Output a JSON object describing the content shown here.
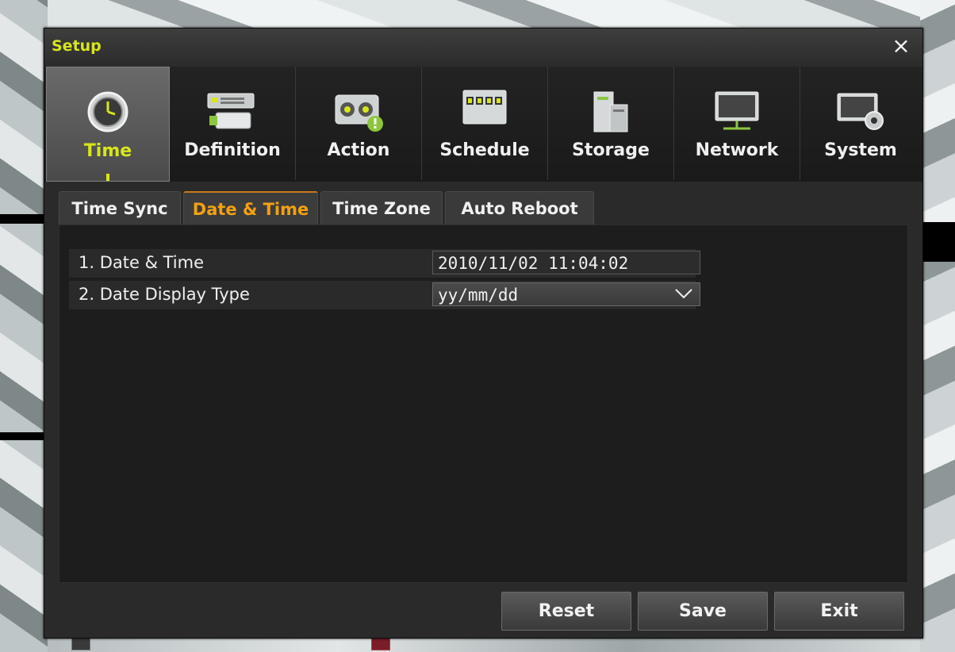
{
  "window": {
    "title": "Setup",
    "close_glyph": "×"
  },
  "main_tabs": [
    {
      "label": "Time",
      "icon": "clock-icon",
      "active": true
    },
    {
      "label": "Definition",
      "icon": "camera-definition-icon",
      "active": false
    },
    {
      "label": "Action",
      "icon": "alarm-action-icon",
      "active": false
    },
    {
      "label": "Schedule",
      "icon": "calendar-schedule-icon",
      "active": false
    },
    {
      "label": "Storage",
      "icon": "storage-icon",
      "active": false
    },
    {
      "label": "Network",
      "icon": "monitor-network-icon",
      "active": false
    },
    {
      "label": "System",
      "icon": "system-gear-icon",
      "active": false
    }
  ],
  "sub_tabs": [
    {
      "label": "Time Sync",
      "active": false
    },
    {
      "label": "Date & Time",
      "active": true
    },
    {
      "label": "Time Zone",
      "active": false
    },
    {
      "label": "Auto Reboot",
      "active": false
    }
  ],
  "settings": {
    "date_time": {
      "label": "1. Date & Time",
      "value": "2010/11/02  11:04:02"
    },
    "date_display": {
      "label": "2. Date Display Type",
      "value": "yy/mm/dd"
    }
  },
  "buttons": {
    "reset": "Reset",
    "save": "Save",
    "exit": "Exit"
  },
  "colors": {
    "accent_yellow": "#d8e61a",
    "active_subtab": "#f4a012"
  }
}
